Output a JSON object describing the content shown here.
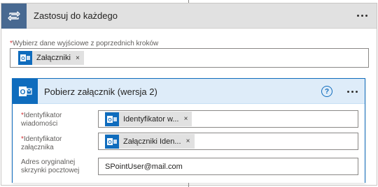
{
  "loop": {
    "title": "Zastosuj do każdego",
    "icon": "loop-icon",
    "select_label_required": "*",
    "select_label": "Wybierz dane wyjściowe z poprzednich kroków",
    "select_token": {
      "label": "Załączniki",
      "icon": "outlook-icon"
    }
  },
  "action": {
    "title": "Pobierz załącznik (wersja 2)",
    "icon": "outlook-icon",
    "help_glyph": "?",
    "params": [
      {
        "required": "*",
        "label_line1": "Identyfikator",
        "label_line2": "wiadomości",
        "token": "Identyfikator w..."
      },
      {
        "required": "*",
        "label_line1": "Identyfikator",
        "label_line2": "załącznika",
        "token": "Załączniki Iden..."
      },
      {
        "required": "",
        "label_line1": "Adres oryginalnej",
        "label_line2": "skrzynki pocztowej",
        "value": "SPointUser@mail.com"
      }
    ]
  },
  "token_close_glyph": "×",
  "colors": {
    "loop_header": "#486991",
    "outlook_blue": "#0f6cbd",
    "required_red": "#d13438",
    "action_header_bg": "#deecf9"
  }
}
